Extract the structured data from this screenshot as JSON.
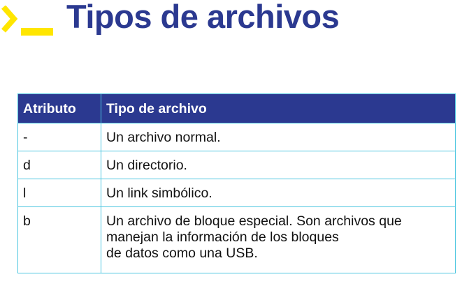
{
  "slide": {
    "title": "Tipos de archivos",
    "brand_color": "#2b3990",
    "accent_color": "#ffe600",
    "logo_icon": "terminal-prompt-icon"
  },
  "table": {
    "headers": [
      "Atributo",
      "Tipo de archivo"
    ],
    "rows": [
      [
        "-",
        "Un archivo normal."
      ],
      [
        "d",
        "Un directorio."
      ],
      [
        "l",
        "Un link simbólico."
      ],
      [
        "b",
        "Un archivo de bloque especial. Son archivos que\nmanejan la información de los bloques\nde datos como una USB."
      ]
    ],
    "border_color": "#4cc6e0",
    "header_bg": "#2b3990"
  }
}
